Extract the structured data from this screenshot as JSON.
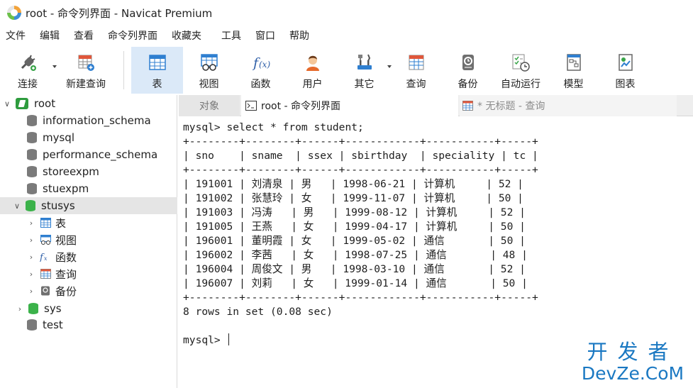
{
  "window": {
    "title": "root - 命令列界面 - Navicat Premium"
  },
  "menu": [
    "文件",
    "编辑",
    "查看",
    "命令列界面",
    "收藏夹",
    "工具",
    "窗口",
    "帮助"
  ],
  "toolbar": {
    "connect": "连接",
    "new_query": "新建查询",
    "table": "表",
    "view": "视图",
    "function": "函数",
    "user": "用户",
    "other": "其它",
    "query": "查询",
    "backup": "备份",
    "automation": "自动运行",
    "model": "模型",
    "chart": "图表"
  },
  "nav": {
    "connection": "root",
    "databases": [
      "information_schema",
      "mysql",
      "performance_schema",
      "storeexpm",
      "stuexpm",
      "stusys",
      "sys",
      "test"
    ],
    "stusys_children": [
      "表",
      "视图",
      "函数",
      "查询",
      "备份"
    ]
  },
  "tabs": {
    "objects": "对象",
    "console": "root - 命令列界面",
    "query": "* 无标题 - 查询"
  },
  "console": {
    "prompt_cmd": "mysql> select * from student;",
    "border": "+--------+--------+------+------------+-----------+-----+",
    "header": "| sno    | sname  | ssex | sbirthday  | speciality | tc |",
    "rows": [
      "| 191001 | 刘清泉 | 男   | 1998-06-21 | 计算机     | 52 |",
      "| 191002 | 张慧玲 | 女   | 1999-11-07 | 计算机     | 50 |",
      "| 191003 | 冯涛   | 男   | 1999-08-12 | 计算机     | 52 |",
      "| 191005 | 王燕   | 女   | 1999-04-17 | 计算机     | 50 |",
      "| 196001 | 董明霞 | 女   | 1999-05-02 | 通信       | 50 |",
      "| 196002 | 李茜   | 女   | 1998-07-25 | 通信       | 48 |",
      "| 196004 | 周俊文 | 男   | 1998-03-10 | 通信       | 52 |",
      "| 196007 | 刘莉   | 女   | 1999-01-14 | 通信       | 50 |"
    ],
    "summary": "8 rows in set (0.08 sec)",
    "prompt": "mysql> "
  },
  "watermark": {
    "cn": "开发者",
    "en": "DevZe.CoM"
  }
}
